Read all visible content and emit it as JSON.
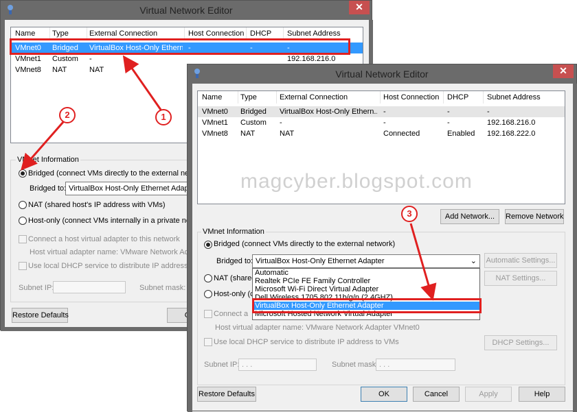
{
  "back_window": {
    "title": "Virtual Network Editor",
    "close_glyph": "✕",
    "columns": [
      "Name",
      "Type",
      "External Connection",
      "Host Connection",
      "DHCP",
      "Subnet Address"
    ],
    "rows": [
      {
        "name": "VMnet0",
        "type": "Bridged",
        "external": "VirtualBox Host-Only Ethern...",
        "host": "-",
        "dhcp": "-",
        "subnet": "-"
      },
      {
        "name": "VMnet1",
        "type": "Custom",
        "external": "-",
        "host": "",
        "dhcp": "",
        "subnet": "192.168.216.0"
      },
      {
        "name": "VMnet8",
        "type": "NAT",
        "external": "NAT",
        "host": "",
        "dhcp": "",
        "subnet": ""
      }
    ],
    "vmnet_info_label": "VMnet Information",
    "bridged_label": "Bridged (connect VMs directly to the external network)",
    "bridged_to_label": "Bridged to:",
    "bridged_to_value": "VirtualBox Host-Only Ethernet Adapter",
    "nat_label": "NAT (shared host's IP address with VMs)",
    "hostonly_label": "Host-only (connect VMs internally in a private network)",
    "connect_adapter_label": "Connect a host virtual adapter to this network",
    "adapter_name_label": "Host virtual adapter name: VMware Network Adapter",
    "dhcp_label": "Use local DHCP service to distribute IP address to VMs",
    "subnet_ip_label": "Subnet IP:",
    "subnet_mask_label": "Subnet mask:",
    "restore_label": "Restore Defaults",
    "ok_partial": "O"
  },
  "front_window": {
    "title": "Virtual Network Editor",
    "close_glyph": "✕",
    "columns": [
      "Name",
      "Type",
      "External Connection",
      "Host Connection",
      "DHCP",
      "Subnet Address"
    ],
    "rows": [
      {
        "name": "VMnet0",
        "type": "Bridged",
        "external": "VirtualBox Host-Only Ethern...",
        "host": "-",
        "dhcp": "-",
        "subnet": "-"
      },
      {
        "name": "VMnet1",
        "type": "Custom",
        "external": "-",
        "host": "-",
        "dhcp": "-",
        "subnet": "192.168.216.0"
      },
      {
        "name": "VMnet8",
        "type": "NAT",
        "external": "NAT",
        "host": "Connected",
        "dhcp": "Enabled",
        "subnet": "192.168.222.0"
      }
    ],
    "add_network_label": "Add Network...",
    "remove_network_label": "Remove Network",
    "vmnet_info_label": "VMnet Information",
    "bridged_label": "Bridged (connect VMs directly to the external network)",
    "bridged_to_label": "Bridged to:",
    "bridged_to_value": "VirtualBox Host-Only Ethernet Adapter",
    "auto_settings_label": "Automatic Settings...",
    "nat_label_partial": "NAT (shared",
    "nat_settings_label": "NAT Settings...",
    "hostonly_label_partial": "Host-only (c",
    "connect_adapter_partial": "Connect a",
    "adapter_name_label": "Host virtual adapter name: VMware Network Adapter VMnet0",
    "dhcp_label": "Use local DHCP service to distribute IP address to VMs",
    "dhcp_settings_label": "DHCP Settings...",
    "subnet_ip_label": "Subnet IP:",
    "subnet_mask_label": "Subnet mask:",
    "ip_placeholder": ".     .     .",
    "restore_label": "Restore Defaults",
    "ok_label": "OK",
    "cancel_label": "Cancel",
    "apply_label": "Apply",
    "help_label": "Help",
    "dropdown_options": [
      "Automatic",
      "Realtek PCIe FE Family Controller",
      "Microsoft Wi-Fi Direct Virtual Adapter",
      "Dell Wireless 1705 802.11b/g/n (2.4GHZ)",
      "VirtualBox Host-Only Ethernet Adapter",
      "Microsoft Hosted Network Virtual Adapter"
    ]
  },
  "watermark": "magcyber.blogspot.com",
  "annotations": {
    "one": "1",
    "two": "2",
    "three": "3"
  },
  "colors": {
    "accent": "#e02020",
    "selection": "#3399ff",
    "titlebar": "#6b6b6b",
    "close": "#c75050"
  }
}
